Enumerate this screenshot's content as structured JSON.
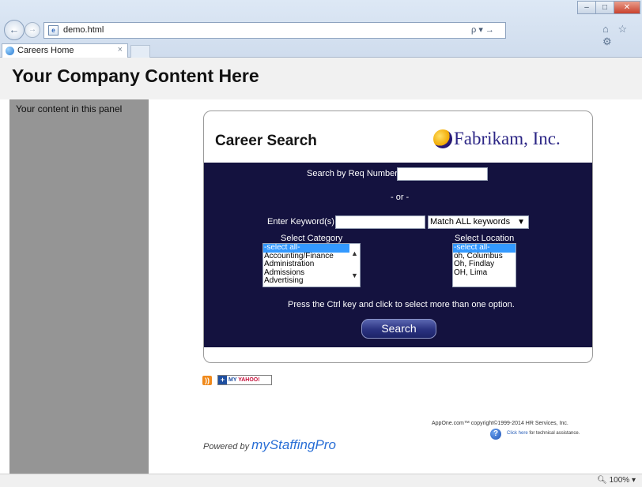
{
  "browser": {
    "address": "demo.html",
    "tab_title": "Careers Home",
    "tab_close": "×",
    "search_arrow": "ρ ▾ →",
    "chrome_icons": "⌂ ☆ ⚙",
    "zoom": "100%"
  },
  "page": {
    "header_title": "Your Company Content Here",
    "left_panel_text": "Your content in this panel"
  },
  "widget": {
    "title": "Career Search",
    "logo_text": "Fabrikam, Inc.",
    "req_label": "Search by Req Number",
    "req_value": "",
    "or_label": "- or -",
    "keyword_label": "Enter Keyword(s)",
    "keyword_value": "",
    "match_selected": "Match ALL keywords",
    "category_label": "Select Category",
    "categories": [
      {
        "label": "-select all-",
        "selected": true
      },
      {
        "label": "Accounting/Finance",
        "selected": false
      },
      {
        "label": "Administration",
        "selected": false
      },
      {
        "label": "Admissions",
        "selected": false
      },
      {
        "label": "Advertising",
        "selected": false
      }
    ],
    "location_label": "Select Location",
    "locations": [
      {
        "label": "-select all-",
        "selected": true
      },
      {
        "label": "oh, Columbus",
        "selected": false
      },
      {
        "label": "Oh, Findlay",
        "selected": false
      },
      {
        "label": "OH, Lima",
        "selected": false
      }
    ],
    "hint": "Press the Ctrl key and click to select more than one option.",
    "search_button": "Search"
  },
  "footer": {
    "myyahoo_prefix": "MY",
    "myyahoo_brand": "YAHOO!",
    "powered_by": "Powered by",
    "powered_brand": "myStaffingPro",
    "copyright": "AppOne.com™   copyright©1999-2014 HR Services, Inc.",
    "help_link": "Click here",
    "help_text": " for technical assistance."
  }
}
